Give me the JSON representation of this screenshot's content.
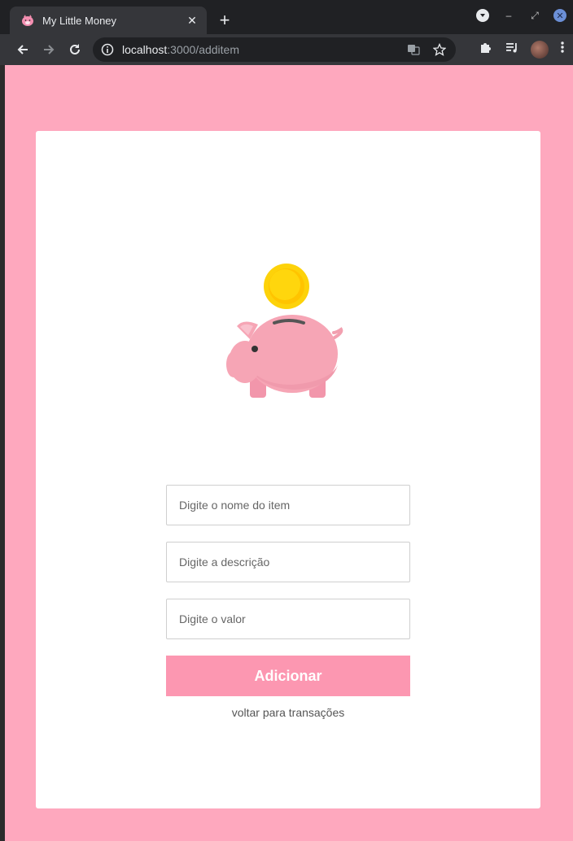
{
  "browser": {
    "tab_title": "My Little Money",
    "url_host": "localhost",
    "url_path": ":3000/additem",
    "icons": {
      "favicon": "pig-icon",
      "close": "close-icon",
      "new_tab": "plus-icon",
      "back": "arrow-left-icon",
      "forward": "arrow-right-icon",
      "reload": "reload-icon",
      "info": "info-icon",
      "translate": "translate-icon",
      "bookmark": "star-icon",
      "extensions": "puzzle-icon",
      "media": "playlist-icon",
      "menu": "kebab-menu-icon"
    }
  },
  "page": {
    "background_color": "#fea8be",
    "form": {
      "name_placeholder": "Digite o nome do item",
      "description_placeholder": "Digite a descrição",
      "value_placeholder": "Digite o valor",
      "submit_label": "Adicionar",
      "back_link": "voltar para transações"
    },
    "colors": {
      "button": "#fc97b1",
      "pig": "#f5a3b3",
      "coin": "#ffd30a"
    }
  }
}
